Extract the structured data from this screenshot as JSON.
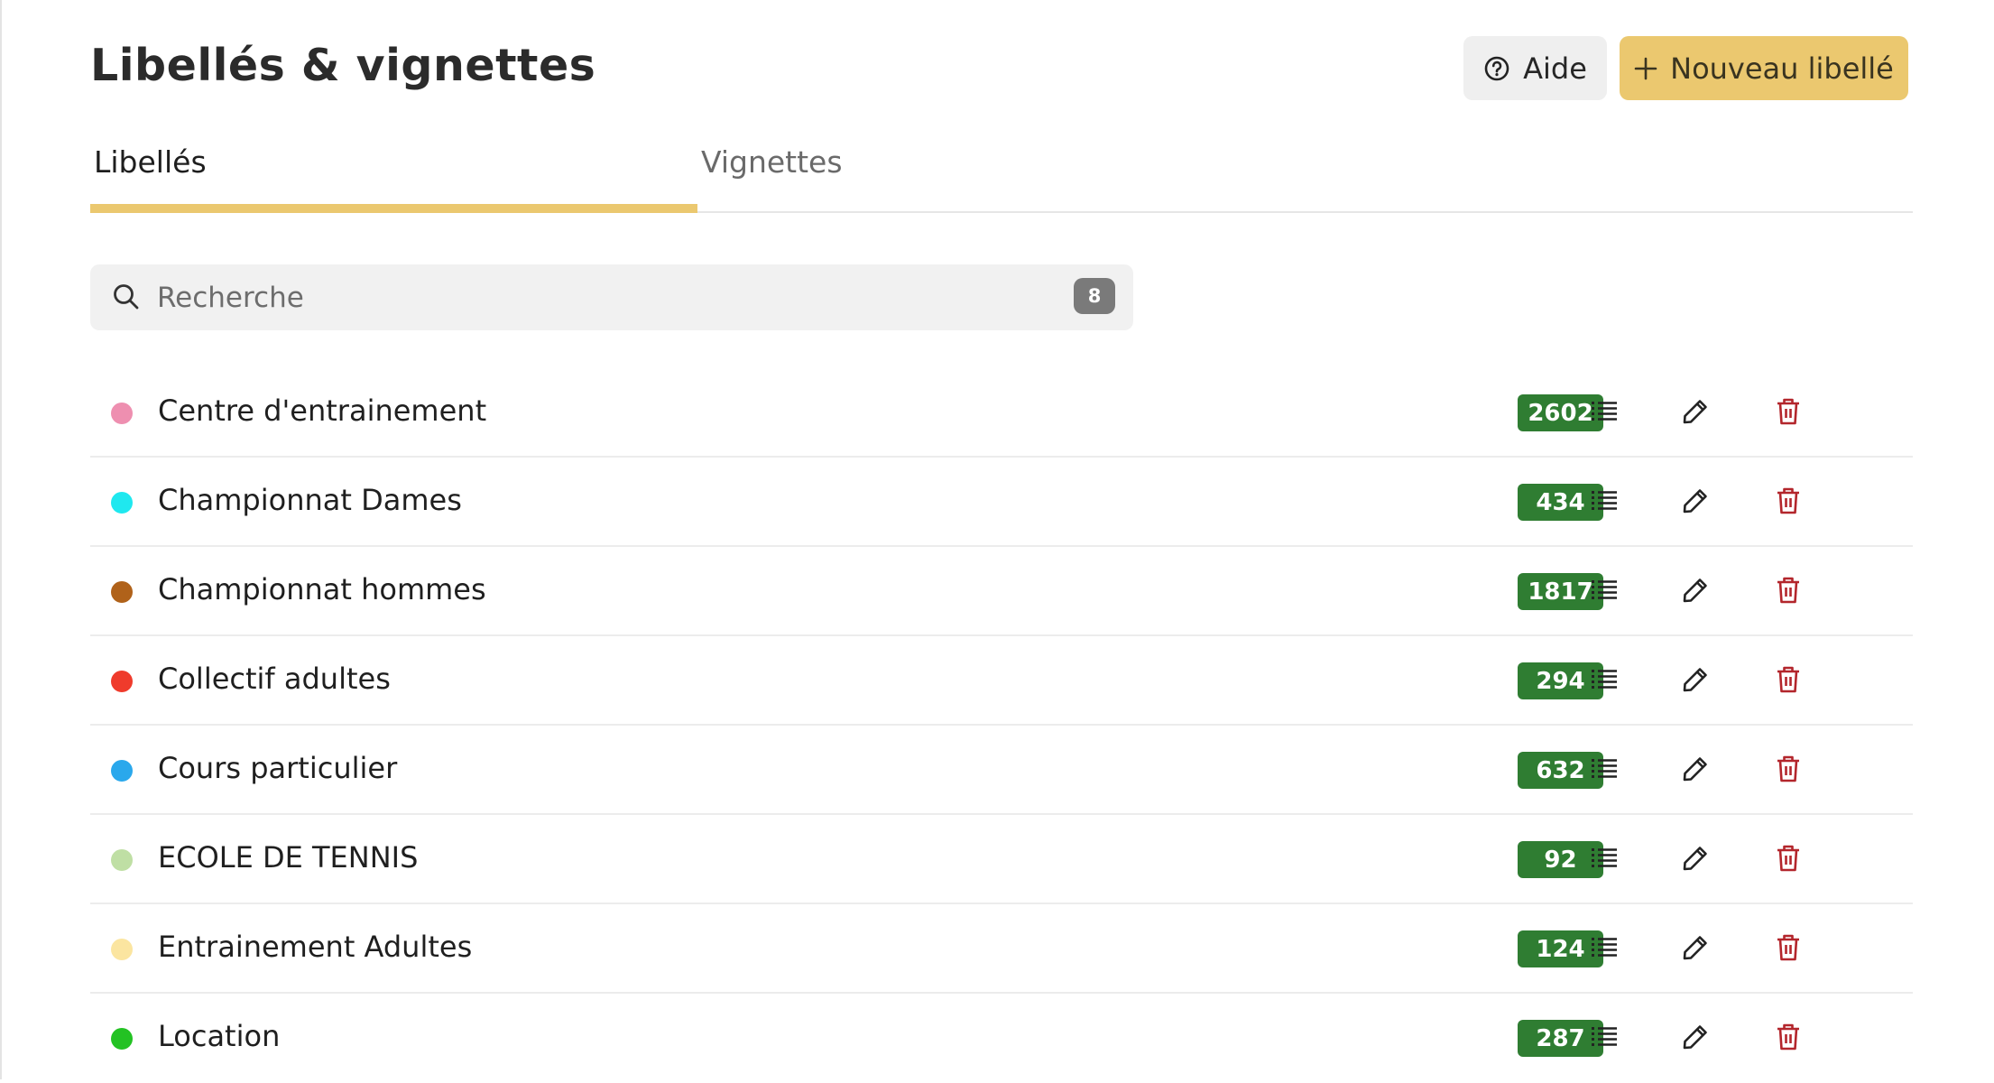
{
  "header": {
    "title": "Libellés & vignettes",
    "help_label": "Aide",
    "new_label": "Nouveau libellé"
  },
  "tabs": [
    {
      "label": "Libellés",
      "active": true
    },
    {
      "label": "Vignettes",
      "active": false
    }
  ],
  "search": {
    "placeholder": "Recherche",
    "value": "",
    "count": "8"
  },
  "labels": [
    {
      "name": "Centre d'entrainement",
      "color": "#ee8fb0",
      "count": "2602"
    },
    {
      "name": "Championnat Dames",
      "color": "#1fe8ef",
      "count": "434"
    },
    {
      "name": "Championnat hommes",
      "color": "#b0621a",
      "count": "1817"
    },
    {
      "name": "Collectif adultes",
      "color": "#ef3b2c",
      "count": "294"
    },
    {
      "name": "Cours particulier",
      "color": "#2aa8ec",
      "count": "632"
    },
    {
      "name": "ECOLE DE TENNIS",
      "color": "#bfdfa4",
      "count": "92"
    },
    {
      "name": "Entrainement Adultes",
      "color": "#fbe5a0",
      "count": "124"
    },
    {
      "name": "Location",
      "color": "#23c223",
      "count": "287"
    }
  ],
  "icons": {
    "help": "help-circle-icon",
    "add": "plus-icon",
    "search": "search-icon",
    "list": "list-icon",
    "edit": "pencil-icon",
    "delete": "trash-icon"
  },
  "colors": {
    "accent": "#ebc86f",
    "count_badge": "#2f7d32",
    "delete": "#b3262c"
  }
}
